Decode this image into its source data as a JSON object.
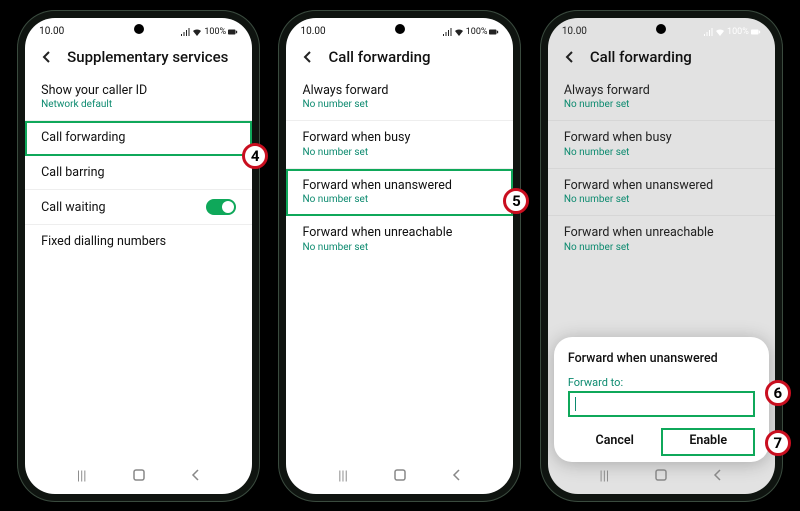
{
  "status": {
    "time": "10.00",
    "battery": "100%"
  },
  "phone1": {
    "title": "Supplementary services",
    "rows": {
      "r1": {
        "label": "Show your caller ID",
        "sub": "Network default"
      },
      "r2": {
        "label": "Call forwarding"
      },
      "r3": {
        "label": "Call barring"
      },
      "r4": {
        "label": "Call waiting"
      },
      "r5": {
        "label": "Fixed dialling numbers"
      }
    },
    "step": "4"
  },
  "phone2": {
    "title": "Call forwarding",
    "rows": {
      "r1": {
        "label": "Always forward",
        "sub": "No number set"
      },
      "r2": {
        "label": "Forward when busy",
        "sub": "No number set"
      },
      "r3": {
        "label": "Forward when unanswered",
        "sub": "No number set"
      },
      "r4": {
        "label": "Forward when unreachable",
        "sub": "No number set"
      }
    },
    "step": "5"
  },
  "phone3": {
    "title": "Call forwarding",
    "rows": {
      "r1": {
        "label": "Always forward",
        "sub": "No number set"
      },
      "r2": {
        "label": "Forward when busy",
        "sub": "No number set"
      },
      "r3": {
        "label": "Forward when unanswered",
        "sub": "No number set"
      },
      "r4": {
        "label": "Forward when unreachable",
        "sub": "No number set"
      }
    },
    "dialog": {
      "title": "Forward when unanswered",
      "label": "Forward to:",
      "cancel": "Cancel",
      "enable": "Enable"
    },
    "step6": "6",
    "step7": "7"
  }
}
